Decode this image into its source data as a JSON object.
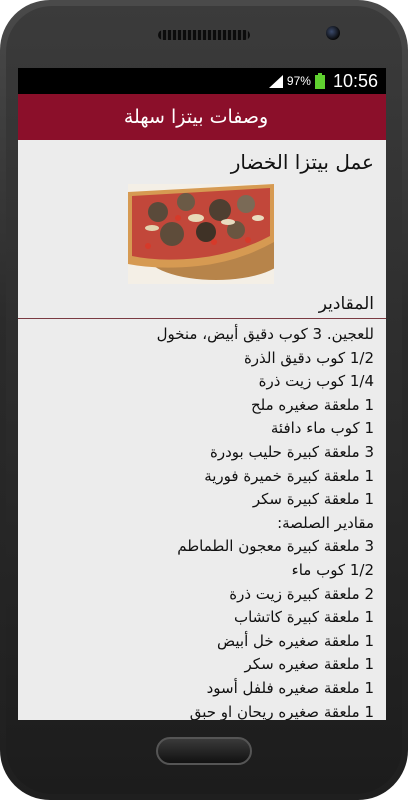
{
  "status": {
    "battery_pct": "97%",
    "time": "10:56"
  },
  "app": {
    "title": "وصفات بيتزا سهلة"
  },
  "recipe": {
    "title": "عمل بيتزا الخضار",
    "ingredients_heading": "المقادير",
    "lines": [
      "للعجين. 3 كوب دقيق أبيض، منخول",
      "1/2 كوب دقيق الذرة",
      "1/4 كوب زيت ذرة",
      "1 ملعقة صغيره ملح",
      "1 كوب ماء دافئة",
      "3 ملعقة كبيرة حليب بودرة",
      "1 ملعقة كبيرة خميرة فورية",
      "1 ملعقة كبيرة سكر",
      "مقادير الصلصة:",
      "3 ملعقة كبيرة معجون الطماطم",
      "1/2 كوب ماء",
      "2 ملعقة كبيرة زيت ذرة",
      "1 ملعقة كبيرة كاتشاب",
      "1 ملعقة صغيره خل أبيض",
      "1 ملعقة صغيره سكر",
      "1 ملعقة صغيره فلفل أسود",
      "1 ملعقة صغيره ريحان او حبق"
    ]
  },
  "colors": {
    "appbar": "#8b0f2a",
    "background": "#ececec"
  }
}
